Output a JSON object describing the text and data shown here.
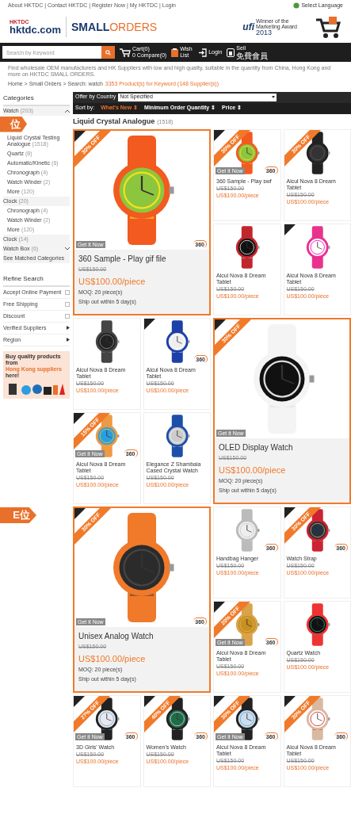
{
  "top_links": "About HKTDC | Contact HKTDC | Register Now | My HKTDC | Login",
  "language": "Select Language",
  "logo": {
    "brand": "HKTDC",
    "site": "hktdc.com",
    "name_bold": "SMALL",
    "name_light": "ORDERS"
  },
  "award": {
    "org": "ufi",
    "text": "Winner of the Marketing Award",
    "year": "2013"
  },
  "search": {
    "placeholder": "Search by Keyword",
    "cart": "Cart(0)",
    "compare": "0 Compare(0)",
    "wish": "Wish List",
    "login": "Login",
    "sell": "Sell",
    "sell_sub": "免費會員"
  },
  "notice": "Find wholesale OEM manufacturers and HK Suppliers with low and high quality, suitable in the quantity from China, Hong Kong and more on HKTDC SMALL ORDERS.",
  "breadcrumb": {
    "path": "Home > Small Orders > Search: watch",
    "result": "3353 Product(s) for Keyword (148 Supplier(s))"
  },
  "sidebar": {
    "title": "Categories",
    "items": [
      {
        "label": "Watch",
        "count": "(203)",
        "expanded": true,
        "indent": false
      },
      {
        "label": "Liquid Crystal Testing Analogue",
        "count": "(1518)",
        "indent": true
      },
      {
        "label": "Quartz",
        "count": "(8)",
        "indent": true
      },
      {
        "label": "Automatic/Kinetic",
        "count": "(6)",
        "indent": true
      },
      {
        "label": "Chronograph",
        "count": "(4)",
        "indent": true
      },
      {
        "label": "Watch Winder",
        "count": "(2)",
        "indent": true
      },
      {
        "label": "More",
        "count": "(120)",
        "indent": true
      },
      {
        "label": "Clock",
        "count": "(20)",
        "indent": false
      },
      {
        "label": "Chronograph",
        "count": "(4)",
        "indent": true
      },
      {
        "label": "Watch Winder",
        "count": "(2)",
        "indent": true
      },
      {
        "label": "More",
        "count": "(120)",
        "indent": true
      },
      {
        "label": "Clock",
        "count": "(14)",
        "indent": false
      },
      {
        "label": "Watch Box",
        "count": "(6)",
        "expanded": false,
        "indent": false
      },
      {
        "label": "See Matched Categories",
        "indent": false
      }
    ],
    "refine_title": "Refine Search",
    "filters": [
      {
        "label": "Accept Online Payment",
        "kind": "checkbox",
        "checked": false
      },
      {
        "label": "Free Shipping",
        "kind": "checkbox",
        "checked": false
      },
      {
        "label": "Discount",
        "kind": "checkbox",
        "checked": false
      },
      {
        "label": "Verified Suppliers",
        "kind": "arrow"
      },
      {
        "label": "Region",
        "kind": "arrow"
      }
    ],
    "promo": {
      "text": "Buy quality products from",
      "link": "Hong Kong suppliers",
      "tail": "here!"
    }
  },
  "filter_bar": {
    "country_label": "Offer by Country",
    "country_value": "Not Specified",
    "sort_label": "Sort by:",
    "sorts": [
      {
        "label": "What's New ⇕",
        "selected": true
      },
      {
        "label": "Minimum Order Quantity ⇕",
        "selected": false
      },
      {
        "label": "Price ⇕",
        "selected": false
      }
    ]
  },
  "heading": {
    "title": "Liquid Crystal Analogue",
    "count": "(1518)"
  },
  "products": [
    {
      "kind": "featured",
      "name": "360 Sample - Play gif file",
      "old_price": "US$150.00",
      "price": "US$100.00/piece",
      "moq": "MOQ: 20 piece(s)",
      "ship": "Ship out within 5 day(s)",
      "discount": "30% OFF",
      "new": true,
      "tag": "Get it Now",
      "badge": "360"
    },
    {
      "kind": "small",
      "name": "360 Sample - Play swf",
      "old_price": "US$150.00",
      "price": "US$100.00/piece",
      "discount": "30% OFF",
      "new": true,
      "tag": "Get it Now",
      "badge": "360"
    },
    {
      "kind": "small",
      "name": "Alcul Nova 8 Dream Tablet",
      "old_price": "US$150.00",
      "price": "US$100.00/piece",
      "discount": "30% OFF",
      "new": false
    },
    {
      "kind": "small",
      "name": "Alcul Nova 8 Dream Tablet",
      "old_price": "US$150.00",
      "price": "US$100.00/piece",
      "new": false
    },
    {
      "kind": "small",
      "name": "Alcul Nova 8 Dream Tablet",
      "old_price": "US$150.00",
      "price": "US$100.00/piece",
      "new": true
    },
    {
      "kind": "small",
      "name": "Alcul Nova 8 Dream Tablet",
      "old_price": "US$150.00",
      "price": "US$100.00/piece",
      "new": false
    },
    {
      "kind": "small",
      "name": "Alcul Nova 8 Dream Tablet",
      "old_price": "US$150.00",
      "price": "US$100.00/piece",
      "new": true,
      "badge": "360"
    },
    {
      "kind": "featured",
      "name": "OLED Display Watch",
      "old_price": "US$150.00",
      "price": "US$100.00/piece",
      "moq": "MOQ: 20 piece(s)",
      "ship": "Ship out within 5 day(s)",
      "discount": "30% OFF",
      "new": true,
      "tag": "Get it Now"
    },
    {
      "kind": "small",
      "name": "Alcul Nova 8 Dream Tablet",
      "old_price": "US$150.00",
      "price": "US$100.00/piece",
      "discount": "15% OFF",
      "new": true,
      "tag": "Get it Now",
      "badge": "360"
    },
    {
      "kind": "small",
      "name": "Elegance Z Shambala Cased Crystal Watch",
      "old_price": "US$150.00",
      "price": "US$100.00/piece",
      "new": false
    },
    {
      "kind": "featured",
      "name": "Unisex Analog Watch",
      "old_price": "US$150.00",
      "price": "US$100.00/piece",
      "moq": "MOQ: 20 piece(s)",
      "ship": "Ship out within 5 day(s)",
      "discount": "30% OFF",
      "new": true,
      "tag": "Get it Now",
      "badge": "360"
    },
    {
      "kind": "small",
      "name": "Handbag Hanger",
      "old_price": "US$150.00",
      "price": "US$100.00/piece",
      "new": false,
      "badge": "360"
    },
    {
      "kind": "small",
      "name": "Watch Strap",
      "old_price": "US$150.00",
      "price": "US$100.00/piece",
      "discount": "30% OFF",
      "new": true,
      "badge": "360"
    },
    {
      "kind": "small",
      "name": "Alcul Nova 8 Dream Tablet",
      "old_price": "US$150.00",
      "price": "US$100.00/piece",
      "discount": "20% OFF",
      "new": true,
      "tag": "Get it Now",
      "badge": "360"
    },
    {
      "kind": "small",
      "name": "Quartz Watch",
      "old_price": "US$150.00",
      "price": "US$100.00/piece",
      "new": false
    },
    {
      "kind": "small",
      "name": "3D Girls' Watch",
      "old_price": "US$150.00",
      "price": "US$100.00/piece",
      "discount": "27% OFF",
      "new": true,
      "tag": "Get it Now",
      "badge": "360"
    },
    {
      "kind": "small",
      "name": "Women's Watch",
      "old_price": "US$150.00",
      "price": "US$100.00/piece",
      "discount": "40% OFF",
      "new": true,
      "badge": "360"
    },
    {
      "kind": "small",
      "name": "Alcul Nova 8 Dream Tablet",
      "old_price": "US$150.00",
      "price": "US$100.00/piece",
      "discount": "30% OFF",
      "new": true,
      "tag": "Get it Now",
      "badge": "360"
    },
    {
      "kind": "small",
      "name": "Alcul Nova 8 Dream Tablet",
      "old_price": "US$150.00",
      "price": "US$100.00/piece",
      "discount": "30% OFF",
      "new": true,
      "badge": "360"
    }
  ],
  "callouts": [
    "位",
    "E位"
  ]
}
